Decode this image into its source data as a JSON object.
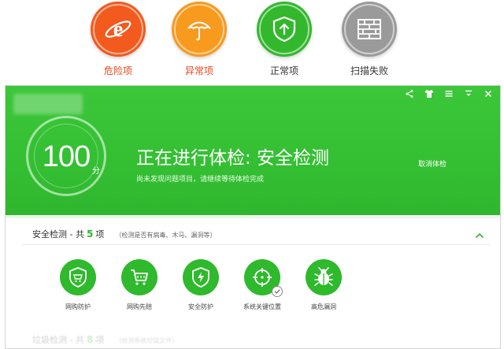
{
  "legend": [
    {
      "label": "危险项",
      "icon": "ie-browser-icon",
      "color": "#f25a1e",
      "text_color": "#e8431c"
    },
    {
      "label": "异常项",
      "icon": "umbrella-icon",
      "color": "#f79a1e",
      "text_color": "#e8431c"
    },
    {
      "label": "正常项",
      "icon": "shield-up-icon",
      "color": "#33b82d",
      "text_color": "#333333"
    },
    {
      "label": "扫描失败",
      "icon": "brick-wall-icon",
      "color": "#9a9a9a",
      "text_color": "#333333"
    }
  ],
  "window": {
    "controls": [
      "share-icon",
      "shirt-icon",
      "menu-icon",
      "dropdown-icon",
      "close-icon"
    ]
  },
  "score": {
    "value": "100",
    "unit": "分"
  },
  "scan": {
    "title": "正在进行体检: 安全检测",
    "subtitle": "尚未发现问题项目，请继续等待体检完成",
    "cancel_label": "取消体检",
    "progress": 0.5
  },
  "section": {
    "prefix": "安全检测 - 共",
    "count": "5",
    "suffix": "项",
    "note": "（检测是否有病毒、木马、漏洞等）",
    "collapse_icon": "chevron-up-icon"
  },
  "items": [
    {
      "label": "网购防护",
      "icon": "shield-cart-icon"
    },
    {
      "label": "网购先赔",
      "icon": "cart-icon"
    },
    {
      "label": "安全防护",
      "icon": "shield-lightning-icon"
    },
    {
      "label": "系统关键位置",
      "icon": "crosshair-icon",
      "checked": true
    },
    {
      "label": "高危漏洞",
      "icon": "bug-icon"
    }
  ],
  "next_section": {
    "prefix": "垃圾检测 - 共",
    "count": "8",
    "suffix": "项",
    "note": "（检测系统垃圾文件）"
  },
  "colors": {
    "accent": "#34bf33",
    "count_green": "#2db52a"
  }
}
